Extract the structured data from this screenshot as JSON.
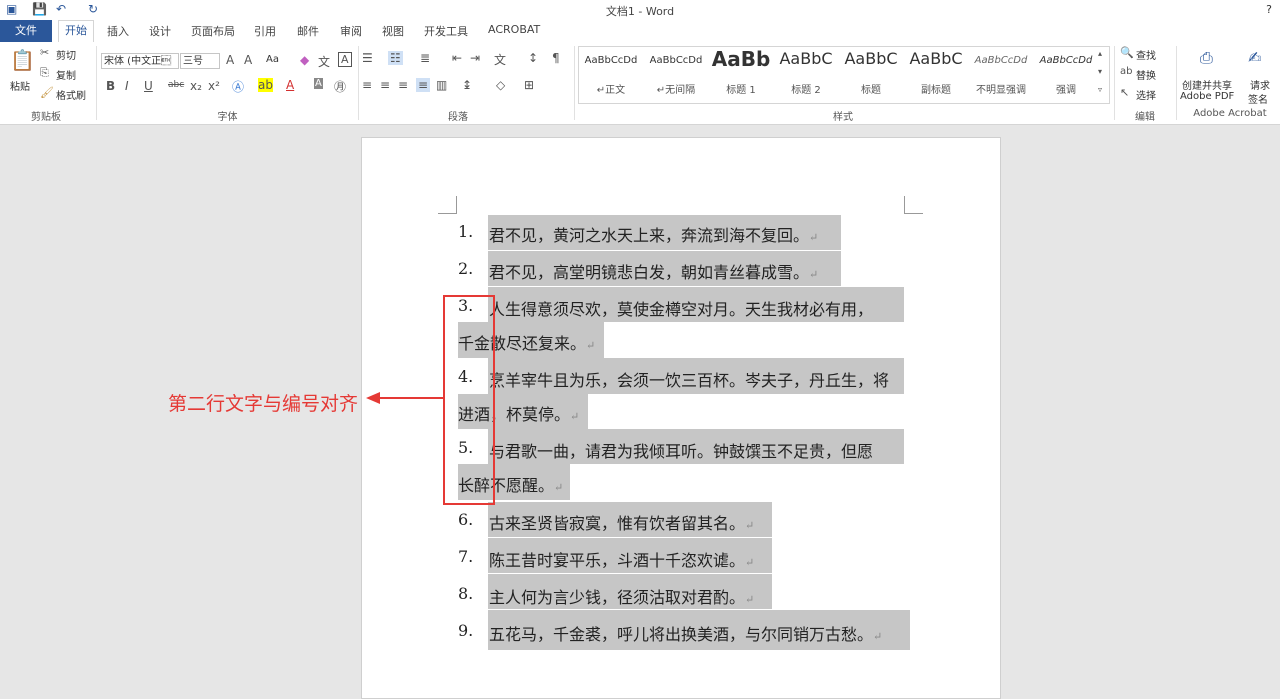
{
  "window": {
    "title": "文档1 - Word",
    "help": "?"
  },
  "tabs": [
    "文件",
    "开始",
    "插入",
    "设计",
    "页面布局",
    "引用",
    "邮件",
    "审阅",
    "视图",
    "开发工具",
    "ACROBAT"
  ],
  "clipboard": {
    "paste": "粘贴",
    "cut": "剪切",
    "copy": "复制",
    "format_painter": "格式刷",
    "label": "剪贴板"
  },
  "font": {
    "name": "宋体 (中文正\u0003",
    "size": "三号",
    "aa_label": "Aa",
    "label": "字体"
  },
  "paragraph": {
    "label": "段落"
  },
  "styles": {
    "label": "样式",
    "items": [
      {
        "preview": "AaBbCcDd",
        "name": "↵正文"
      },
      {
        "preview": "AaBbCcDd",
        "name": "↵无间隔"
      },
      {
        "preview": "AaBb",
        "name": "标题 1"
      },
      {
        "preview": "AaBbC",
        "name": "标题 2"
      },
      {
        "preview": "AaBbC",
        "name": "标题"
      },
      {
        "preview": "AaBbC",
        "name": "副标题"
      },
      {
        "preview": "AaBbCcDd",
        "name": "不明显强调"
      },
      {
        "preview": "AaBbCcDd",
        "name": "强调"
      }
    ]
  },
  "editing": {
    "find": "查找",
    "replace": "替换",
    "select": "选择",
    "label": "编辑"
  },
  "acrobat": {
    "create_line1": "创建并共享",
    "create_line2": "Adobe PDF",
    "sign_line1": "请求",
    "sign_line2": "签名",
    "label": "Adobe Acrobat"
  },
  "document": {
    "lines": [
      {
        "num": "1.",
        "text": "君不见，黄河之水天上来，奔流到海不复回。"
      },
      {
        "num": "2.",
        "text": "君不见，高堂明镜悲白发，朝如青丝暮成雪。"
      },
      {
        "num": "3.",
        "text": "人生得意须尽欢，莫使金樽空对月。天生我材必有用，",
        "cont": "千金散尽还复来。"
      },
      {
        "num": "4.",
        "text": "烹羊宰牛且为乐，会须一饮三百杯。岑夫子，丹丘生，将",
        "cont": "进酒，杯莫停。"
      },
      {
        "num": "5.",
        "text": "与君歌一曲，请君为我倾耳听。钟鼓馔玉不足贵，但愿",
        "cont": "长醉不愿醒。"
      },
      {
        "num": "6.",
        "text": "古来圣贤皆寂寞，惟有饮者留其名。"
      },
      {
        "num": "7.",
        "text": "陈王昔时宴平乐，斗酒十千恣欢谑。"
      },
      {
        "num": "8.",
        "text": "主人何为言少钱，径须沽取对君酌。"
      },
      {
        "num": "9.",
        "text": "五花马，千金裘，呼儿将出换美酒，与尔同销万古愁。"
      }
    ],
    "para_mark": "↵"
  },
  "annotation": {
    "text": "第二行文字与编号对齐"
  }
}
